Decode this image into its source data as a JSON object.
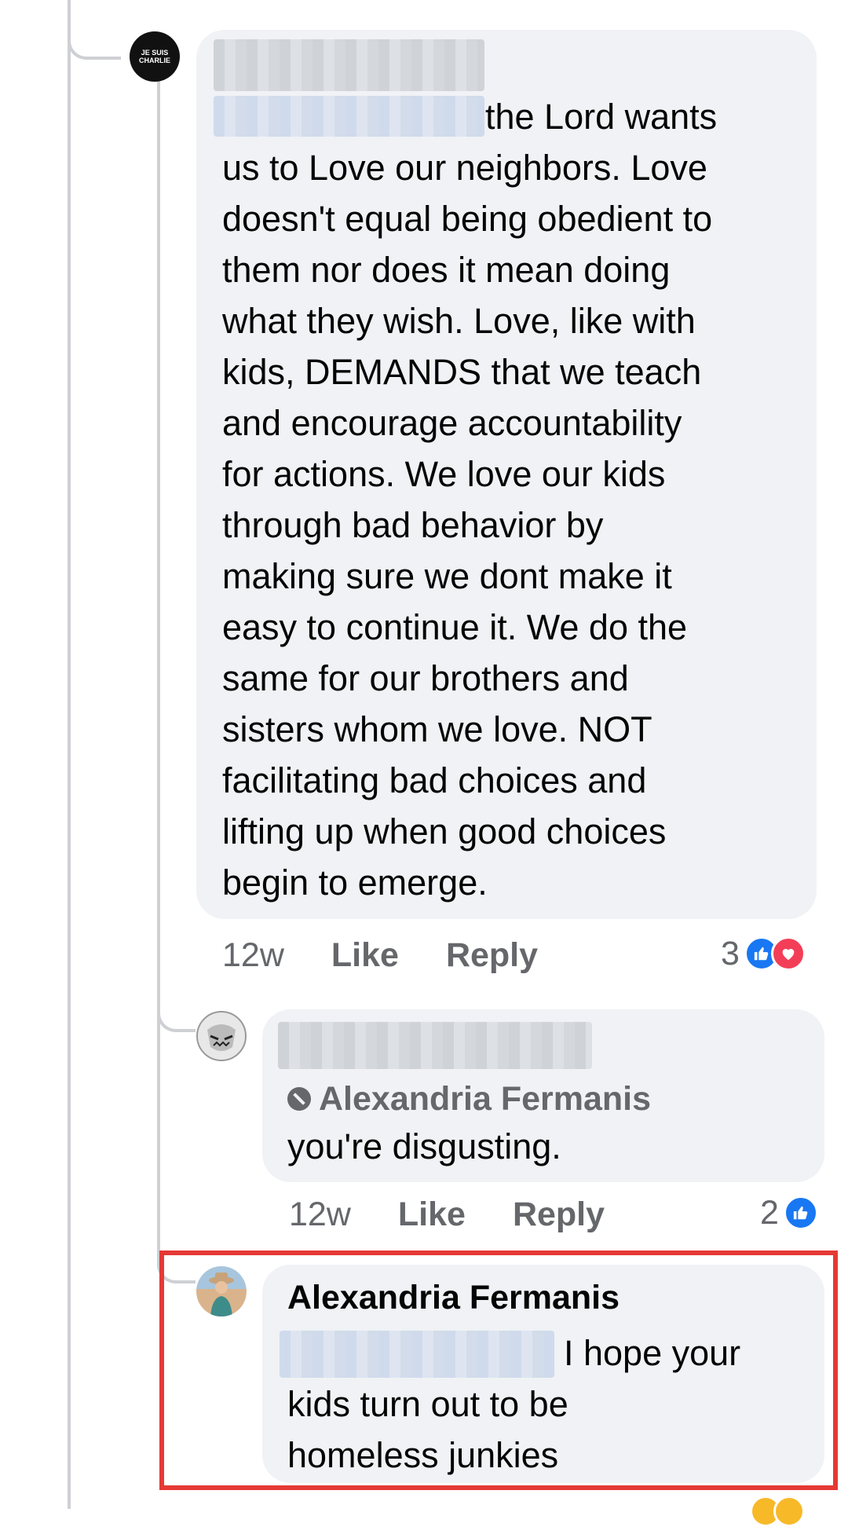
{
  "comment1": {
    "avatar_text": "JE SUIS CHARLIE",
    "body_tail": "the Lord wants",
    "body_rest": "us to Love our neighbors. Love\ndoesn't equal being obedient to\nthem nor does it mean doing\nwhat they wish. Love, like with\nkids, DEMANDS that we teach\nand encourage accountability\nfor actions. We love our kids\nthrough bad behavior by\nmaking sure we dont make it\neasy to continue it. We do the\nsame for our brothers and\nsisters whom we love. NOT\nfacilitating bad choices and\nlifting up when good choices\nbegin to emerge.",
    "time": "12w",
    "like_label": "Like",
    "reply_label": "Reply",
    "reaction_count": "3"
  },
  "comment2": {
    "mention": "Alexandria Fermanis",
    "body": "you're disgusting.",
    "time": "12w",
    "like_label": "Like",
    "reply_label": "Reply",
    "reaction_count": "2"
  },
  "comment3": {
    "author": "Alexandria Fermanis",
    "body_tail": "I hope your",
    "body_rest": "kids turn out to be\nhomeless junkies"
  },
  "colors": {
    "like_blue": "#1877f2",
    "love_red": "#f33e58",
    "highlight_red": "#e53935",
    "bubble_gray": "#f0f2f5"
  }
}
